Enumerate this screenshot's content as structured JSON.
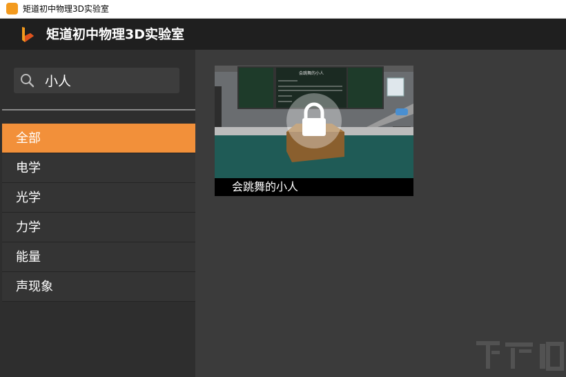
{
  "window": {
    "title": "矩道初中物理3D实验室"
  },
  "header": {
    "title": "矩道初中物理3D实验室"
  },
  "search": {
    "value": "小人"
  },
  "categories": [
    {
      "label": "全部",
      "active": true
    },
    {
      "label": "电学",
      "active": false
    },
    {
      "label": "光学",
      "active": false
    },
    {
      "label": "力学",
      "active": false
    },
    {
      "label": "能量",
      "active": false
    },
    {
      "label": "声现象",
      "active": false
    }
  ],
  "results": [
    {
      "title": "会跳舞的小人",
      "locked": true,
      "board_title": "会跳舞的小人"
    }
  ],
  "colors": {
    "accent": "#f2903a",
    "sidebar": "#2e2e2e",
    "main": "#3b3b3b",
    "header": "#1f1f1f"
  }
}
